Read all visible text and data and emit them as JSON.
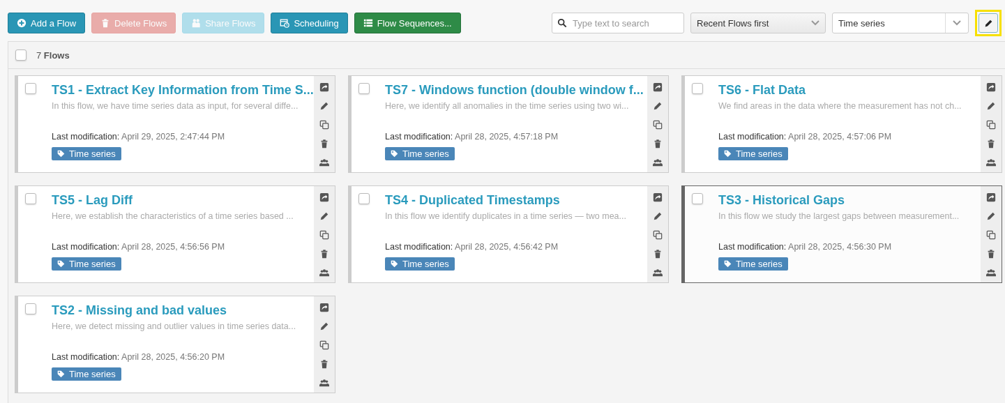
{
  "toolbar": {
    "buttons": [
      {
        "label": "Add a Flow",
        "kind": "add",
        "disabled": false
      },
      {
        "label": "Delete Flows",
        "kind": "delete",
        "disabled": true
      },
      {
        "label": "Share Flows",
        "kind": "share",
        "disabled": true
      },
      {
        "label": "Scheduling",
        "kind": "schedule",
        "disabled": false
      },
      {
        "label": "Flow Sequences...",
        "kind": "sequence",
        "disabled": false
      }
    ],
    "search": {
      "placeholder": "Type text to search"
    },
    "sort": {
      "value": "Recent Flows first"
    },
    "tag_filter": {
      "value": "Time series"
    },
    "edit_button": {
      "highlighted": true
    }
  },
  "list_header": {
    "checked": false,
    "count": "7",
    "label": "Flows"
  },
  "flows": [
    {
      "title": "TS1 - Extract Key Information from Time S...",
      "description": "In this flow, we have time series data as input, for several diffe...",
      "modified_label": "Last modification:",
      "modified": "April 29, 2025, 2:47:44 PM",
      "tag": "Time series",
      "checked": false,
      "hovered": false
    },
    {
      "title": "TS7 - Windows function (double window f...",
      "description": "Here, we identify all anomalies in the time series using two wi...",
      "modified_label": "Last modification:",
      "modified": "April 28, 2025, 4:57:18 PM",
      "tag": "Time series",
      "checked": false,
      "hovered": false
    },
    {
      "title": "TS6 - Flat Data",
      "description": "We find areas in the data where the measurement has not ch...",
      "modified_label": "Last modification:",
      "modified": "April 28, 2025, 4:57:06 PM",
      "tag": "Time series",
      "checked": false,
      "hovered": false
    },
    {
      "title": "TS5 - Lag Diff",
      "description": "Here, we establish the characteristics of a time series based ...",
      "modified_label": "Last modification:",
      "modified": "April 28, 2025, 4:56:56 PM",
      "tag": "Time series",
      "checked": false,
      "hovered": false
    },
    {
      "title": "TS4 - Duplicated Timestamps",
      "description": "In this flow we identify duplicates in a time series — two mea...",
      "modified_label": "Last modification:",
      "modified": "April 28, 2025, 4:56:42 PM",
      "tag": "Time series",
      "checked": false,
      "hovered": false
    },
    {
      "title": "TS3 - Historical Gaps",
      "description": "In this flow we study the largest gaps between measurement...",
      "modified_label": "Last modification:",
      "modified": "April 28, 2025, 4:56:30 PM",
      "tag": "Time series",
      "checked": false,
      "hovered": true
    },
    {
      "title": "TS2 - Missing and bad values",
      "description": "Here, we detect missing and outlier values in time series data...",
      "modified_label": "Last modification:",
      "modified": "April 28, 2025, 4:56:20 PM",
      "tag": "Time series",
      "checked": false,
      "hovered": false
    }
  ]
}
